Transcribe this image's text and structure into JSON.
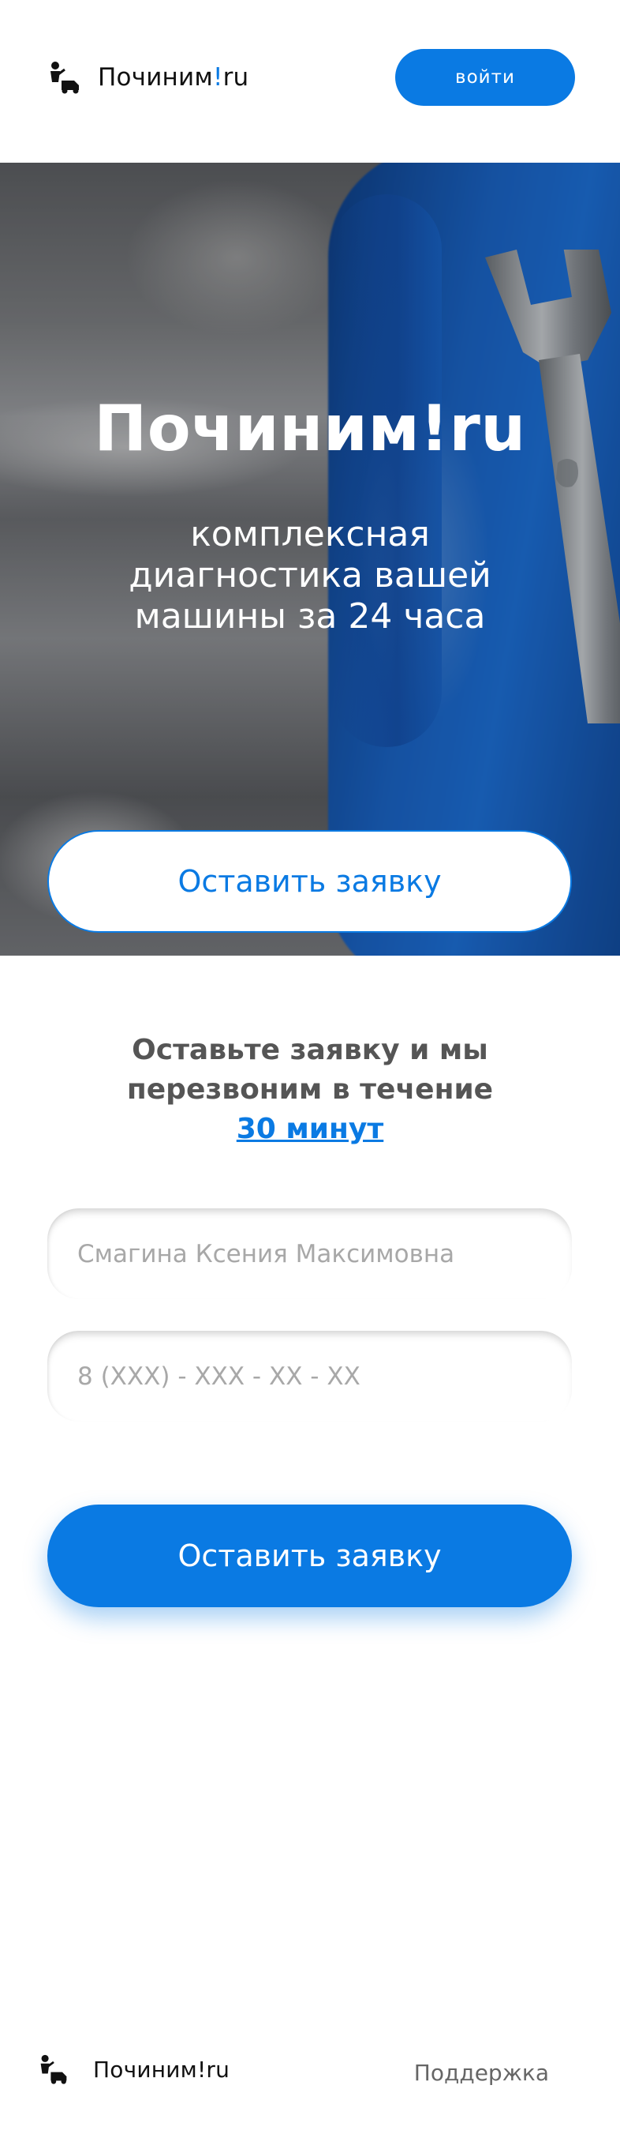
{
  "brand": {
    "name_main": "Починим",
    "name_bang": "!",
    "name_suffix": "ru",
    "accent_color": "#0a7ae3",
    "icon": "mechanic-car-icon"
  },
  "header": {
    "login_label": "войти"
  },
  "hero": {
    "title": "Починим!ru",
    "subtitle": "комплексная диагностика вашей машины за 24 часа",
    "cta_label": "Оставить заявку"
  },
  "form": {
    "title_part1": "Оставьте заявку и мы перезвоним в течение",
    "title_accent": "30 минут",
    "name_placeholder": "Смагина Ксения Максимовна",
    "phone_placeholder": "8 (XXX) - XXX - XX - XX",
    "submit_label": "Оставить заявку"
  },
  "footer": {
    "brand": "Починим!ru",
    "support_label": "Поддержка"
  }
}
